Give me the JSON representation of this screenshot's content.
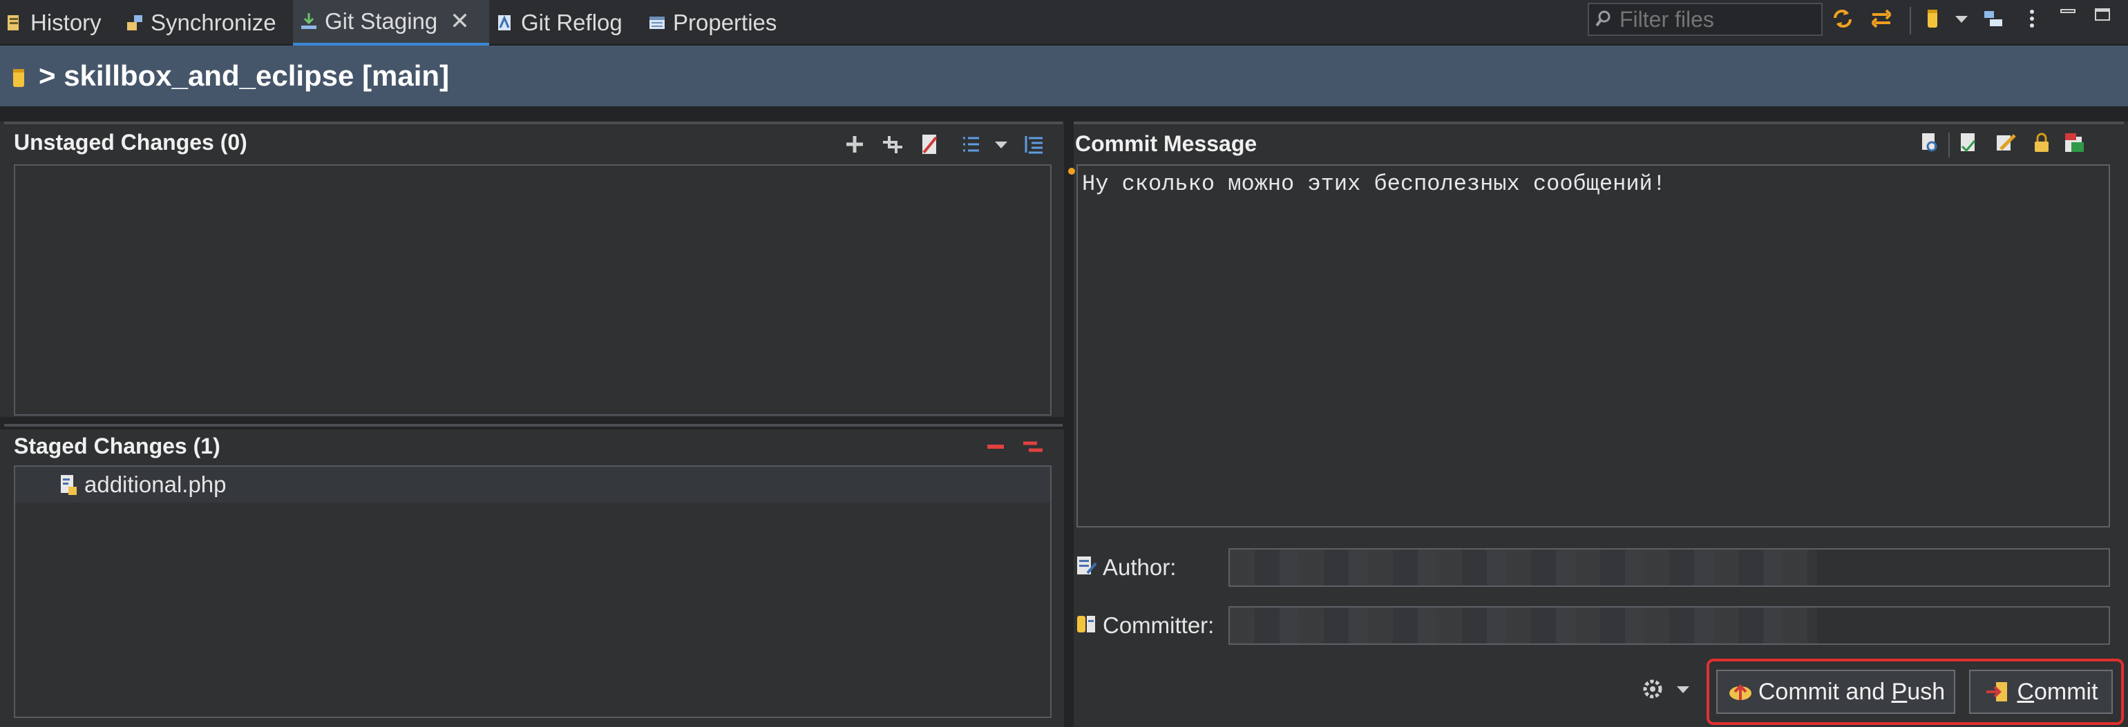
{
  "tabs": [
    {
      "label": "History",
      "icon": "history-icon"
    },
    {
      "label": "Synchronize",
      "icon": "synchronize-icon"
    },
    {
      "label": "Git Staging",
      "icon": "git-staging-icon",
      "active": true
    },
    {
      "label": "Git Reflog",
      "icon": "git-reflog-icon"
    },
    {
      "label": "Properties",
      "icon": "properties-icon"
    }
  ],
  "filter": {
    "placeholder": "Filter files"
  },
  "repo": {
    "title": "> skillbox_and_eclipse [main]"
  },
  "unstaged": {
    "title": "Unstaged Changes (0)",
    "items": []
  },
  "staged": {
    "title": "Staged Changes (1)",
    "items": [
      {
        "name": "additional.php"
      }
    ]
  },
  "commit": {
    "title": "Commit Message",
    "message": "Ну сколько можно этих бесполезных сообщений!",
    "author_label": "Author:",
    "committer_label": "Committer:",
    "commit_push_pre": "Commit and ",
    "commit_push_key": "P",
    "commit_push_post": "ush",
    "commit_key": "C",
    "commit_post": "ommit"
  },
  "colors": {
    "accent": "#3a87d6",
    "highlight": "#e0302f",
    "header": "#46566a"
  }
}
